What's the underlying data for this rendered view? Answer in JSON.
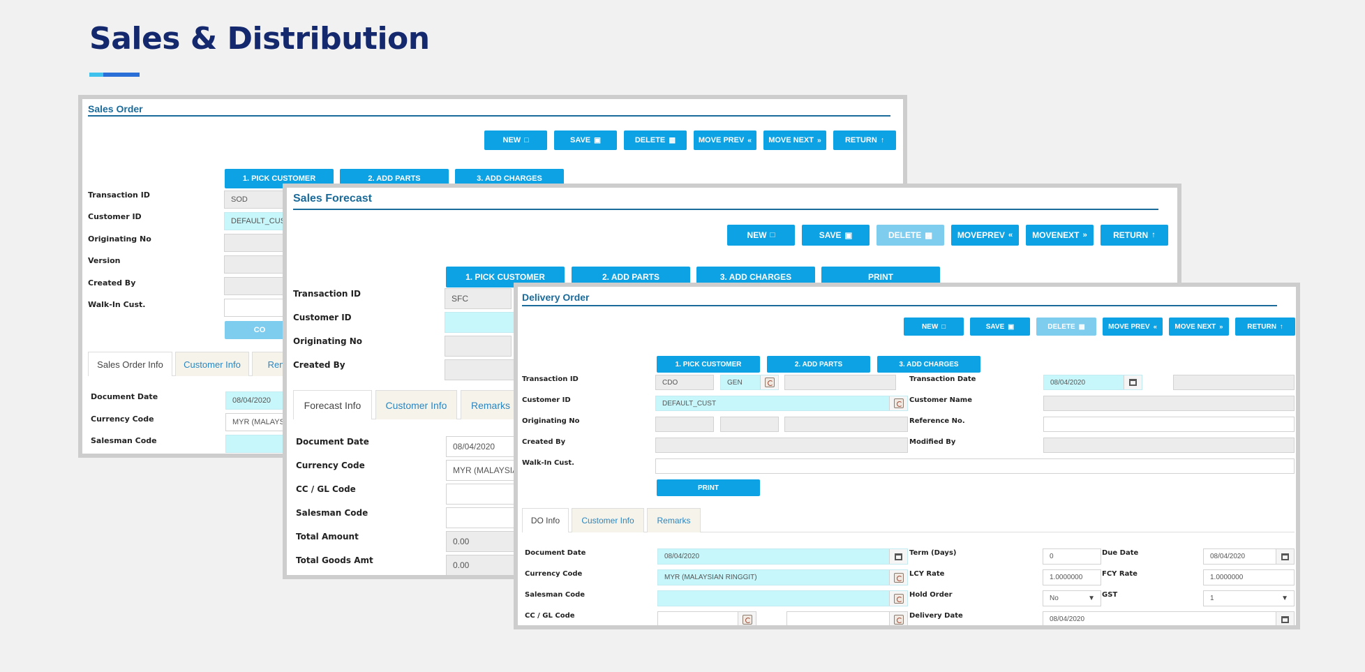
{
  "page": {
    "title": "Sales & Distribution"
  },
  "toolbar": {
    "new": "NEW",
    "save": "SAVE",
    "delete": "DELETE",
    "move_prev": "MOVE PREV",
    "move_next": "MOVE NEXT",
    "moveprev": "MOVEPREV",
    "movenext": "MOVENEXT",
    "return": "RETURN"
  },
  "steps": {
    "pick_customer": "1. PICK CUSTOMER",
    "add_parts": "2. ADD PARTS",
    "add_charges": "3. ADD CHARGES",
    "print": "PRINT"
  },
  "sales_order": {
    "title": "Sales Order",
    "labels": {
      "transaction_id": "Transaction ID",
      "customer_id": "Customer ID",
      "originating_no": "Originating No",
      "version": "Version",
      "created_by": "Created By",
      "walk_in": "Walk-In Cust.",
      "document_date": "Document Date",
      "currency_code": "Currency Code",
      "salesman_code": "Salesman Code"
    },
    "values": {
      "transaction_id": "SOD",
      "customer_id": "DEFAULT_CUS",
      "document_date": "08/04/2020",
      "currency_code": "MYR (MALAYS"
    },
    "partial_button": "CO",
    "tabs": [
      "Sales Order Info",
      "Customer Info",
      "Rema"
    ]
  },
  "sales_forecast": {
    "title": "Sales Forecast",
    "labels": {
      "transaction_id": "Transaction ID",
      "customer_id": "Customer ID",
      "originating_no": "Originating No",
      "created_by": "Created By",
      "document_date": "Document Date",
      "currency_code": "Currency Code",
      "cc_gl_code": "CC / GL Code",
      "salesman_code": "Salesman Code",
      "total_amount": "Total Amount",
      "total_goods_amt": "Total Goods Amt"
    },
    "values": {
      "transaction_id": "SFC",
      "document_date": "08/04/2020",
      "currency_code": "MYR (MALAYSIA",
      "total_amount": "0.00",
      "total_goods_amt": "0.00"
    },
    "tabs": [
      "Forecast Info",
      "Customer Info",
      "Remarks"
    ]
  },
  "delivery_order": {
    "title": "Delivery Order",
    "labels": {
      "transaction_id": "Transaction ID",
      "customer_id": "Customer ID",
      "originating_no": "Originating No",
      "created_by": "Created By",
      "walk_in": "Walk-In Cust.",
      "transaction_date": "Transaction Date",
      "customer_name": "Customer Name",
      "reference_no": "Reference No.",
      "modified_by": "Modified By",
      "document_date": "Document Date",
      "currency_code": "Currency Code",
      "salesman_code": "Salesman Code",
      "cc_gl_code": "CC / GL Code",
      "term_days": "Term (Days)",
      "lcy_rate": "LCY Rate",
      "hold_order": "Hold Order",
      "delivery_date": "Delivery Date",
      "due_date": "Due Date",
      "fcy_rate": "FCY Rate",
      "gst": "GST"
    },
    "values": {
      "transaction_prefix": "CDO",
      "transaction_type": "GEN",
      "transaction_date": "08/04/2020",
      "customer_id": "DEFAULT_CUST",
      "document_date": "08/04/2020",
      "currency_code": "MYR (MALAYSIAN RINGGIT)",
      "term_days": "0",
      "lcy_rate": "1.0000000",
      "hold_order": "No",
      "delivery_date": "08/04/2020",
      "due_date": "08/04/2020",
      "fcy_rate": "1.0000000",
      "gst": "1"
    },
    "tabs": [
      "DO Info",
      "Customer Info",
      "Remarks"
    ]
  },
  "icons": {
    "new": "file-icon",
    "save": "floppy-disk-icon",
    "delete": "trash-icon",
    "prev": "double-chevron-left-icon",
    "next": "double-chevron-right-icon",
    "return": "arrow-up-icon",
    "refresh": "refresh-icon",
    "calendar": "calendar-icon"
  },
  "colors": {
    "title": "#14286e",
    "accent": "#0da2e3",
    "window_heading": "#1a6a9a",
    "cyan_field": "#c7f7fb"
  }
}
